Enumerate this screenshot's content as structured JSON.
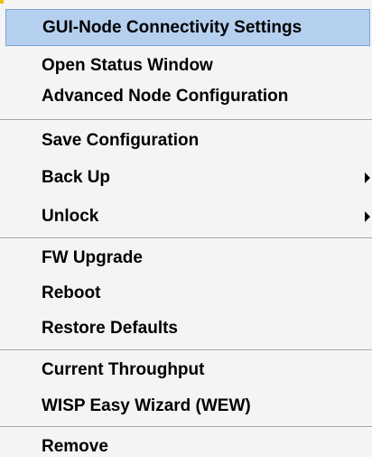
{
  "context_menu": {
    "items": [
      {
        "label": "GUI-Node Connectivity Settings"
      },
      {
        "label": "Open Status Window"
      },
      {
        "label": "Advanced Node Configuration"
      },
      {
        "label": "Save Configuration"
      },
      {
        "label": "Back Up"
      },
      {
        "label": "Unlock"
      },
      {
        "label": "FW Upgrade"
      },
      {
        "label": "Reboot"
      },
      {
        "label": "Restore Defaults"
      },
      {
        "label": "Current Throughput"
      },
      {
        "label": "WISP Easy Wizard (WEW)"
      },
      {
        "label": "Remove"
      }
    ],
    "highlight_color": "#b5d0ef"
  }
}
